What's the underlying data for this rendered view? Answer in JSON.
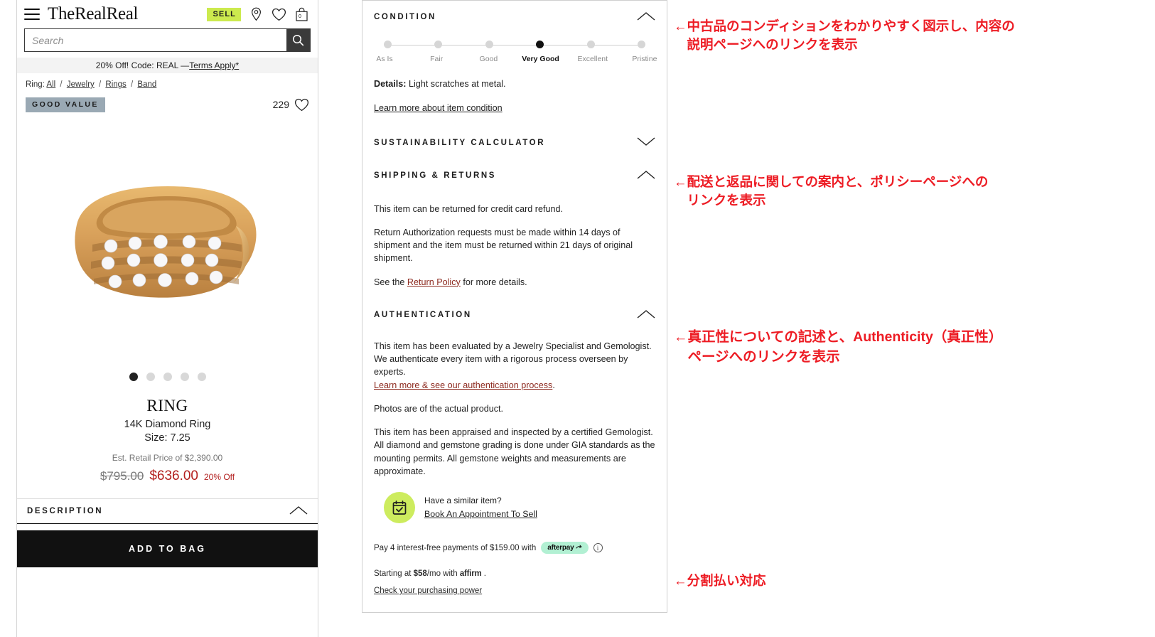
{
  "header": {
    "brand": "TheRealReal",
    "menu_icon": "hamburger-icon",
    "sell_label": "SELL",
    "store_icon": "location-pin-icon",
    "wishlist_icon": "heart-icon",
    "bag_icon": "shopping-bag-icon",
    "bag_count": "0"
  },
  "search": {
    "placeholder": "Search",
    "value": "",
    "icon": "search-icon"
  },
  "promo": {
    "text": "20% Off! Code: REAL — ",
    "link": "Terms Apply*"
  },
  "breadcrumb": {
    "prefix": "Ring:",
    "items": [
      "All",
      "Jewelry",
      "Rings",
      "Band"
    ],
    "separator": "/"
  },
  "product": {
    "badge": "GOOD VALUE",
    "fav_count": "229",
    "fav_icon": "heart-icon",
    "title": "RING",
    "subtitle": "14K Diamond Ring",
    "size": "Size: 7.25",
    "retail": "Est. Retail Price of $2,390.00",
    "price_original": "$795.00",
    "price_current": "$636.00",
    "discount": "20% Off",
    "image_alt": "gold-diamond-ring-photo",
    "carousel_dots": 5,
    "carousel_active": 0
  },
  "description_section": {
    "label": "DESCRIPTION",
    "chevron": "chevron-up-icon"
  },
  "add_to_bag": "ADD TO BAG",
  "condition": {
    "heading": "CONDITION",
    "chevron": "chevron-up-icon",
    "steps": [
      "As Is",
      "Fair",
      "Good",
      "Very Good",
      "Excellent",
      "Pristine"
    ],
    "selected_index": 3,
    "details_label": "Details:",
    "details_text": " Light scratches at metal.",
    "learn_more": "Learn more about item condition"
  },
  "sustainability": {
    "heading": "SUSTAINABILITY CALCULATOR",
    "chevron": "chevron-down-icon"
  },
  "shipping": {
    "heading": "SHIPPING & RETURNS",
    "chevron": "chevron-up-icon",
    "p1": "This item can be returned for credit card refund.",
    "p2": "Return Authorization requests must be made within 14 days of shipment and the item must be returned within 21 days of original shipment.",
    "p3_pre": "See the ",
    "p3_link": "Return Policy",
    "p3_post": " for more details."
  },
  "authentication": {
    "heading": "AUTHENTICATION",
    "chevron": "chevron-up-icon",
    "p1": "This item has been evaluated by a Jewelry Specialist and Gemologist. We authenticate every item with a rigorous process overseen by experts.",
    "p1_link": "Learn more & see our authentication process",
    "p1_link_post": ".",
    "p2": "Photos are of the actual product.",
    "p3": "This item has been appraised and inspected by a certified Gemologist. All diamond and gemstone grading is done under GIA standards as the mounting permits. All gemstone weights and measurements are approximate."
  },
  "sell_promo": {
    "icon": "calendar-check-icon",
    "question": "Have a similar item?",
    "cta": "Book An Appointment To Sell"
  },
  "payments": {
    "afterpay_text": "Pay 4 interest-free payments of $159.00 with",
    "afterpay_brand": "afterpay",
    "info_icon": "info-icon",
    "affirm_pre": "Starting at ",
    "affirm_amount": "$58",
    "affirm_mid": "/mo with ",
    "affirm_brand": "affirm",
    "affirm_post": " .",
    "purchasing_power": "Check your purchasing power"
  },
  "annotations": [
    "←中古品のコンディションをわかりやすく図示し、内容の\n　説明ページへのリンクを表示",
    "←配送と返品に関しての案内と、ポリシーページへの\n　リンクを表示",
    "←真正性についての記述と、Authenticity（真正性）\n　ページへのリンクを表示",
    "←分割払い対応"
  ],
  "colors": {
    "annotation_red": "#ed1c24",
    "sell_green": "#ccea4e",
    "badge_blue_gray": "#9aa9b4",
    "price_red": "#b3201f",
    "link_maroon": "#8d2a1f",
    "afterpay_mint": "#b2f0d3"
  }
}
